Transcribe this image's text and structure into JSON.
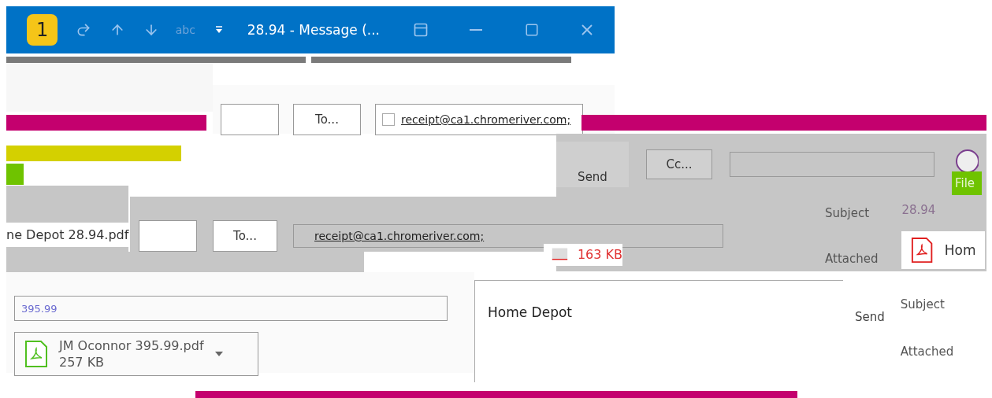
{
  "title_bar": {
    "badge": "1",
    "title": "28.94 - Message (...",
    "quick_access": [
      {
        "kind": "redo"
      },
      {
        "kind": "up"
      },
      {
        "kind": "down"
      },
      {
        "kind": "spelling",
        "label": "abc",
        "disabled": true
      },
      {
        "kind": "more"
      }
    ]
  },
  "top_compose": {
    "to_button": "To...",
    "checked": false,
    "recipient": "receipt@ca1.chromeriver.com;"
  },
  "side_panel": {
    "send_button": "Send",
    "cc_button": "Cc...",
    "file_tab": "File",
    "subject_label": "Subject",
    "subject": "28.94",
    "attached_label": "Attached",
    "attachment_name": "Hom"
  },
  "middle_compose": {
    "attachment_name": "ne Depot 28.94.pdf",
    "to_button": "To...",
    "recipient": "receipt@ca1.chromeriver.com;",
    "attachment_size": "163 KB"
  },
  "bottom_compose": {
    "subject": "395.99",
    "attachment": {
      "name": "JM Oconnor 395.99.pdf",
      "size": "257 KB"
    },
    "body": "Home Depot"
  },
  "right_panel": {
    "send_button": "Send",
    "subject_label": "Subject",
    "attached_label": "Attached"
  }
}
